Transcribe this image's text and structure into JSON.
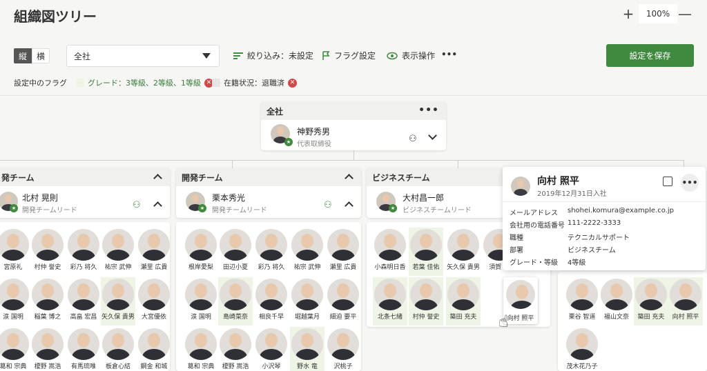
{
  "header": {
    "title": "組織図ツリー",
    "zoom_in": "+",
    "zoom_level": "100%",
    "zoom_out": "—"
  },
  "toolbar": {
    "orient_vertical": "縦",
    "orient_horizontal": "横",
    "select_value": "全社",
    "filter_label": "絞り込み：未設定",
    "flag_label": "フラグ設定",
    "display_label": "表示操作",
    "more": "•••",
    "save_label": "設定を保存"
  },
  "flags": {
    "label": "設定中のフラグ",
    "items": [
      {
        "text": "グレード：3等級、2等級、1等級"
      },
      {
        "text": "在籍状況：退職済"
      }
    ]
  },
  "root": {
    "title": "全社",
    "leader_name": "神野秀男",
    "leader_role": "代表取締役"
  },
  "teams": [
    {
      "title": "発チーム",
      "leader_name": "北村 晃則",
      "leader_role": "開発チームリード",
      "members": [
        "宮原礼",
        "村仲 誉史",
        "彩乃 将久",
        "祐宗 武伸",
        "瀬里 広貴",
        "涙 国明",
        "稲葉 博之",
        "高畠 宏昌",
        "矢久保 貴男",
        "大宮優依",
        "葛和 宗典",
        "榎野 嵩浩",
        "有馬琉唯",
        "板倉心結",
        "鋼金 和城"
      ]
    },
    {
      "title": "開発チーム",
      "leader_name": "栗本秀光",
      "leader_role": "開発チームリード",
      "members": [
        "根岸愛梨",
        "田辺小夏",
        "彩乃 将久",
        "祐宗 武伸",
        "瀬里 広貴",
        "涙 国明",
        "島崎菜奈",
        "相良千早",
        "堀越葉月",
        "細迫 要平",
        "葛和 宗典",
        "榎野 嵩浩",
        "小沢琴",
        "野水 竜",
        "沢桃子"
      ]
    },
    {
      "title": "ビジネスチーム",
      "leader_name": "大村昌一郎",
      "leader_role": "ビジネスチームリード",
      "members": [
        "小森明日香",
        "若葉 佳佑",
        "矢久保 貴男",
        "須賀 清",
        "北条七緒",
        "村仲 誉史",
        "築田 充夫"
      ]
    }
  ],
  "team4_members": [
    "栗谷 智道",
    "福山文奈",
    "築田 充夫",
    "向村 照平",
    "茂木花乃子"
  ],
  "popup": {
    "name": "向村 照平",
    "joined": "2019年12月31日入社",
    "rows": [
      {
        "label": "メールアドレス",
        "value": "shohei.komura@example.co.jp"
      },
      {
        "label": "会社用の電話番号",
        "value": "111-2222-3333"
      },
      {
        "label": "職種",
        "value": "テクニカルサポート"
      },
      {
        "label": "部署",
        "value": "ビジネスチーム"
      },
      {
        "label": "グレード・等級",
        "value": "4等級"
      }
    ]
  },
  "dragged_member": "向村 照平"
}
